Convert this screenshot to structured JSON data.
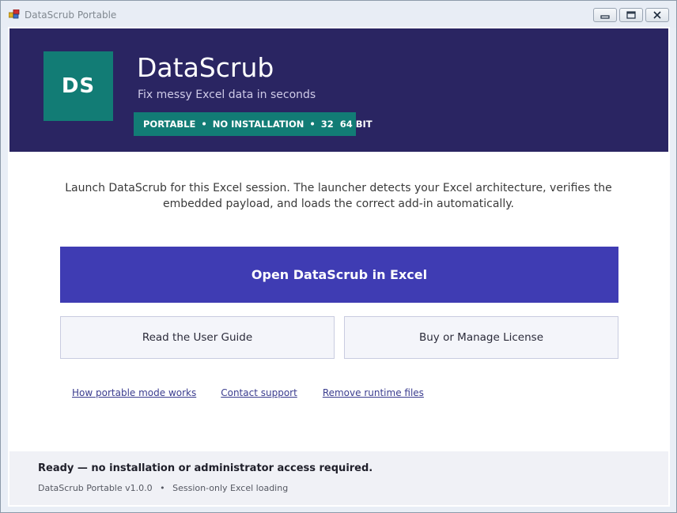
{
  "window": {
    "title": "DataScrub Portable",
    "controls": [
      "minimize",
      "maximize",
      "close"
    ]
  },
  "header": {
    "logo_text": "DS",
    "app_name": "DataScrub",
    "tagline": "Fix messy Excel data in seconds",
    "badge": {
      "items": [
        "PORTABLE",
        "NO INSTALLATION",
        "32  64 BIT"
      ],
      "separator": "•"
    },
    "colors": {
      "background": "#2a2562",
      "accent": "#127c75"
    }
  },
  "main": {
    "description": "Launch DataScrub for this Excel session. The launcher detects your Excel architecture, verifies the embedded payload, and loads the correct add-in automatically.",
    "primary_button": "Open DataScrub in Excel",
    "primary_color": "#3f3cb3",
    "secondary_buttons": {
      "guide": "Read the User Guide",
      "license": "Buy or Manage License"
    },
    "links": {
      "portable": "How portable mode works",
      "support": "Contact support",
      "remove": "Remove runtime files"
    }
  },
  "footer": {
    "status": "Ready — no installation or administrator access required.",
    "version": "DataScrub Portable v1.0.0",
    "separator": "•",
    "mode": "Session-only Excel loading"
  }
}
